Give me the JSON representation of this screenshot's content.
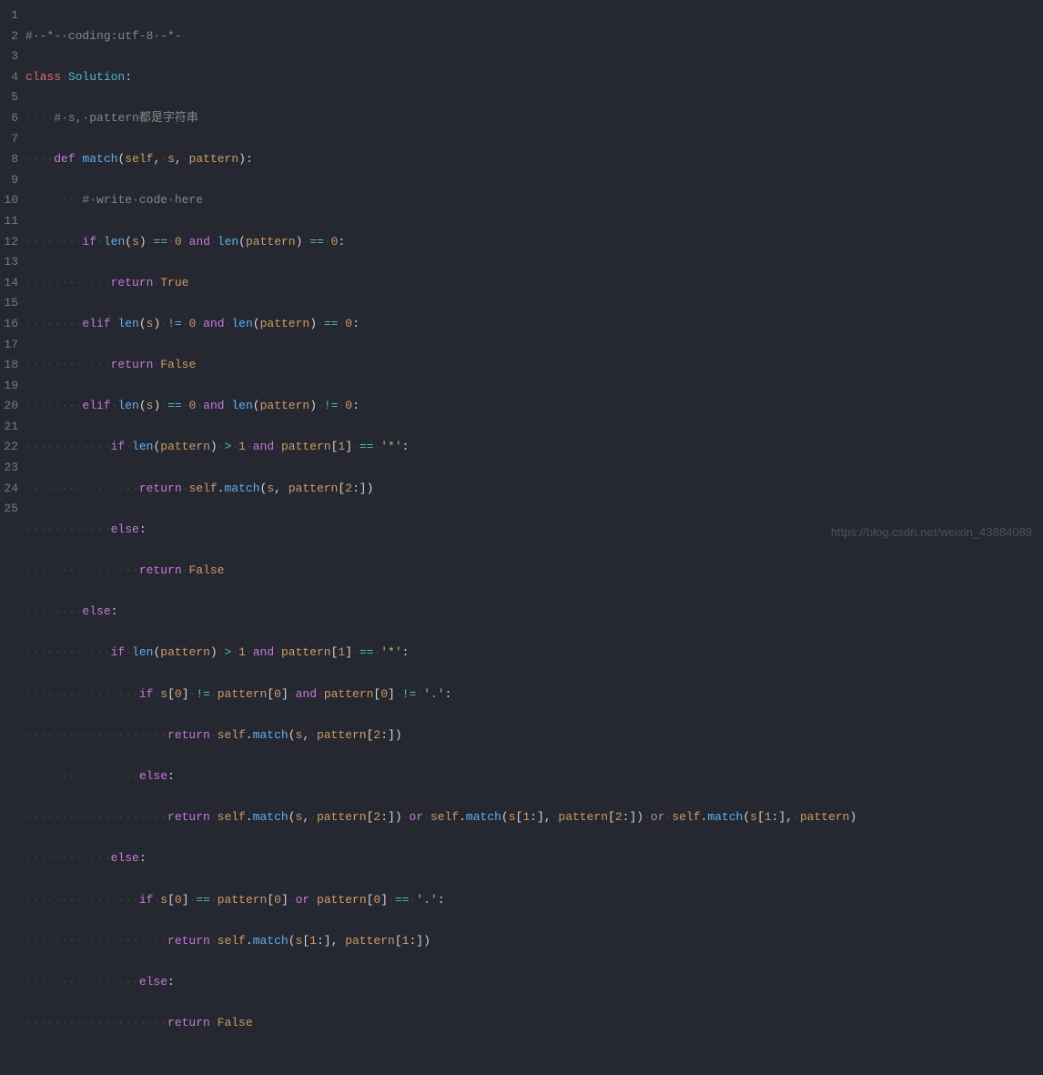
{
  "watermark": "https://blog.csdn.net/weixin_43884089",
  "gutter": [
    "1",
    "2",
    "3",
    "4",
    "5",
    "6",
    "7",
    "8",
    "9",
    "10",
    "11",
    "12",
    "13",
    "14",
    "15",
    "16",
    "17",
    "18",
    "19",
    "20",
    "21",
    "22",
    "23",
    "24",
    "25"
  ],
  "code": {
    "l1": {
      "c1": "#",
      "c2": "·-*-·coding:utf-8·-*-"
    },
    "l2": {
      "kw": "class",
      "name": "Solution",
      "p": ":"
    },
    "l3": {
      "ws": "····",
      "c1": "#",
      "c2": "·s,·pattern都是字符串"
    },
    "l4": {
      "ws": "····",
      "kw": "def",
      "fn": "match",
      "lp": "(",
      "p1": "self",
      "cm1": ",",
      "sp1": "·",
      "p2": "s",
      "cm2": ",",
      "sp2": "·",
      "p3": "pattern",
      "rp": ")",
      "col": ":"
    },
    "l5": {
      "ws": "········",
      "c1": "#",
      "c2": "·write·code·here"
    },
    "l6": {
      "ws": "········",
      "kw": "if",
      "sp1": "·",
      "fn": "len",
      "lp": "(",
      "p": "s",
      "rp": ")",
      "sp2": "·",
      "op": "==",
      "sp3": "·",
      "n": "0",
      "sp4": "·",
      "kw2": "and",
      "sp5": "·",
      "fn2": "len",
      "lp2": "(",
      "p2": "pattern",
      "rp2": ")",
      "sp6": "·",
      "op2": "==",
      "sp7": "·",
      "n2": "0",
      "col": ":"
    },
    "l7": {
      "ws": "············",
      "kw": "return",
      "sp": "·",
      "v": "True"
    },
    "l8": {
      "ws": "········",
      "kw": "elif",
      "sp1": "·",
      "fn": "len",
      "lp": "(",
      "p": "s",
      "rp": ")",
      "sp2": "·",
      "op": "!=",
      "sp3": "·",
      "n": "0",
      "sp4": "·",
      "kw2": "and",
      "sp5": "·",
      "fn2": "len",
      "lp2": "(",
      "p2": "pattern",
      "rp2": ")",
      "sp6": "·",
      "op2": "==",
      "sp7": "·",
      "n2": "0",
      "col": ":",
      "sp8": "·"
    },
    "l9": {
      "ws": "············",
      "kw": "return",
      "sp": "·",
      "v": "False"
    },
    "l10": {
      "ws": "········",
      "kw": "elif",
      "sp1": "·",
      "fn": "len",
      "lp": "(",
      "p": "s",
      "rp": ")",
      "sp2": "·",
      "op": "==",
      "sp3": "·",
      "n": "0",
      "sp4": "·",
      "kw2": "and",
      "sp5": "·",
      "fn2": "len",
      "lp2": "(",
      "p2": "pattern",
      "rp2": ")",
      "sp6": "·",
      "op2": "!=",
      "sp7": "·",
      "n2": "0",
      "col": ":"
    },
    "l11": {
      "ws": "············",
      "kw": "if",
      "sp1": "·",
      "fn": "len",
      "lp": "(",
      "p": "pattern",
      "rp": ")",
      "sp2": "·",
      "op": ">",
      "sp3": "·",
      "n": "1",
      "sp4": "·",
      "kw2": "and",
      "sp5": "·",
      "p2": "pattern",
      "lb": "[",
      "n2": "1",
      "rb": "]",
      "sp6": "·",
      "op2": "==",
      "sp7": "·",
      "s": "'*'",
      "col": ":"
    },
    "l12": {
      "ws": "················",
      "kw": "return",
      "sp": "·",
      "slf": "self",
      "dot": ".",
      "fn": "match",
      "lp": "(",
      "p1": "s",
      "cm": ",",
      "sp2": "·",
      "p2": "pattern",
      "lb": "[",
      "n": "2",
      "sl": ":",
      "rb": "]",
      "rp": ")"
    },
    "l13": {
      "ws": "············",
      "kw": "else",
      "col": ":"
    },
    "l14": {
      "ws": "················",
      "kw": "return",
      "sp": "·",
      "v": "False"
    },
    "l15": {
      "ws": "········",
      "kw": "else",
      "col": ":"
    },
    "l16": {
      "ws": "············",
      "kw": "if",
      "sp1": "·",
      "fn": "len",
      "lp": "(",
      "p": "pattern",
      "rp": ")",
      "sp2": "·",
      "op": ">",
      "sp3": "·",
      "n": "1",
      "sp4": "·",
      "kw2": "and",
      "sp5": "·",
      "p2": "pattern",
      "lb": "[",
      "n2": "1",
      "rb": "]",
      "sp6": "·",
      "op2": "==",
      "sp7": "·",
      "s": "'*'",
      "col": ":"
    },
    "l17": {
      "ws": "················",
      "kw": "if",
      "sp1": "·",
      "p1": "s",
      "lb1": "[",
      "n1": "0",
      "rb1": "]",
      "sp2": "·",
      "op1": "!=",
      "sp3": "·",
      "p2": "pattern",
      "lb2": "[",
      "n2": "0",
      "rb2": "]",
      "sp4": "·",
      "kw2": "and",
      "sp5": "·",
      "p3": "pattern",
      "lb3": "[",
      "n3": "0",
      "rb3": "]",
      "sp6": "·",
      "op2": "!=",
      "sp7": "·",
      "s": "'.'",
      "col": ":"
    },
    "l18": {
      "ws": "····················",
      "kw": "return",
      "sp": "·",
      "slf": "self",
      "dot": ".",
      "fn": "match",
      "lp": "(",
      "p1": "s",
      "cm": ",",
      "sp2": "·",
      "p2": "pattern",
      "lb": "[",
      "n": "2",
      "sl": ":",
      "rb": "]",
      "rp": ")"
    },
    "l19": {
      "ws": "················",
      "kw": "else",
      "col": ":"
    },
    "l20": {
      "ws": "····················",
      "kw": "return",
      "sp": "·",
      "slf1": "self",
      "dot1": ".",
      "fn1": "match",
      "lp1": "(",
      "p1": "s",
      "cm1": ",",
      "sp2": "·",
      "p2": "pattern",
      "lb1": "[",
      "n1": "2",
      "sl1": ":",
      "rb1": "]",
      "rp1": ")",
      "sp3": "·",
      "or1": "or",
      "sp4": "·",
      "slf2": "self",
      "dot2": ".",
      "fn2": "match",
      "lp2": "(",
      "p3": "s",
      "lb2": "[",
      "n2": "1",
      "sl2": ":",
      "rb2": "]",
      "cm2": ",",
      "sp5": "·",
      "p4": "pattern",
      "lb3": "[",
      "n3": "2",
      "sl3": ":",
      "rb3": "]",
      "rp2": ")",
      "sp6": "·",
      "or2": "or",
      "sp7": "·",
      "slf3": "self",
      "dot3": ".",
      "fn3": "match",
      "lp3": "(",
      "p5": "s",
      "lb4": "[",
      "n4": "1",
      "sl4": ":",
      "rb4": "]",
      "cm3": ",",
      "sp8": "·",
      "p6": "pattern",
      "rp3": ")"
    },
    "l21": {
      "ws": "············",
      "kw": "else",
      "col": ":"
    },
    "l22": {
      "ws": "················",
      "kw": "if",
      "sp1": "·",
      "p1": "s",
      "lb1": "[",
      "n1": "0",
      "rb1": "]",
      "sp2": "·",
      "op1": "==",
      "sp3": "·",
      "p2": "pattern",
      "lb2": "[",
      "n2": "0",
      "rb2": "]",
      "sp4": "·",
      "kw2": "or",
      "sp5": "·",
      "p3": "pattern",
      "lb3": "[",
      "n3": "0",
      "rb3": "]",
      "sp6": "·",
      "op2": "==",
      "sp7": "·",
      "s": "'.'",
      "col": ":"
    },
    "l23": {
      "ws": "····················",
      "kw": "return",
      "sp": "·",
      "slf": "self",
      "dot": ".",
      "fn": "match",
      "lp": "(",
      "p1": "s",
      "lb1": "[",
      "n1": "1",
      "sl1": ":",
      "rb1": "]",
      "cm": ",",
      "sp2": "·",
      "p2": "pattern",
      "lb2": "[",
      "n2": "1",
      "sl2": ":",
      "rb2": "]",
      "rp": ")"
    },
    "l24": {
      "ws": "················",
      "kw": "else",
      "col": ":"
    },
    "l25": {
      "ws": "····················",
      "kw": "return",
      "sp": "·",
      "v": "False"
    }
  }
}
